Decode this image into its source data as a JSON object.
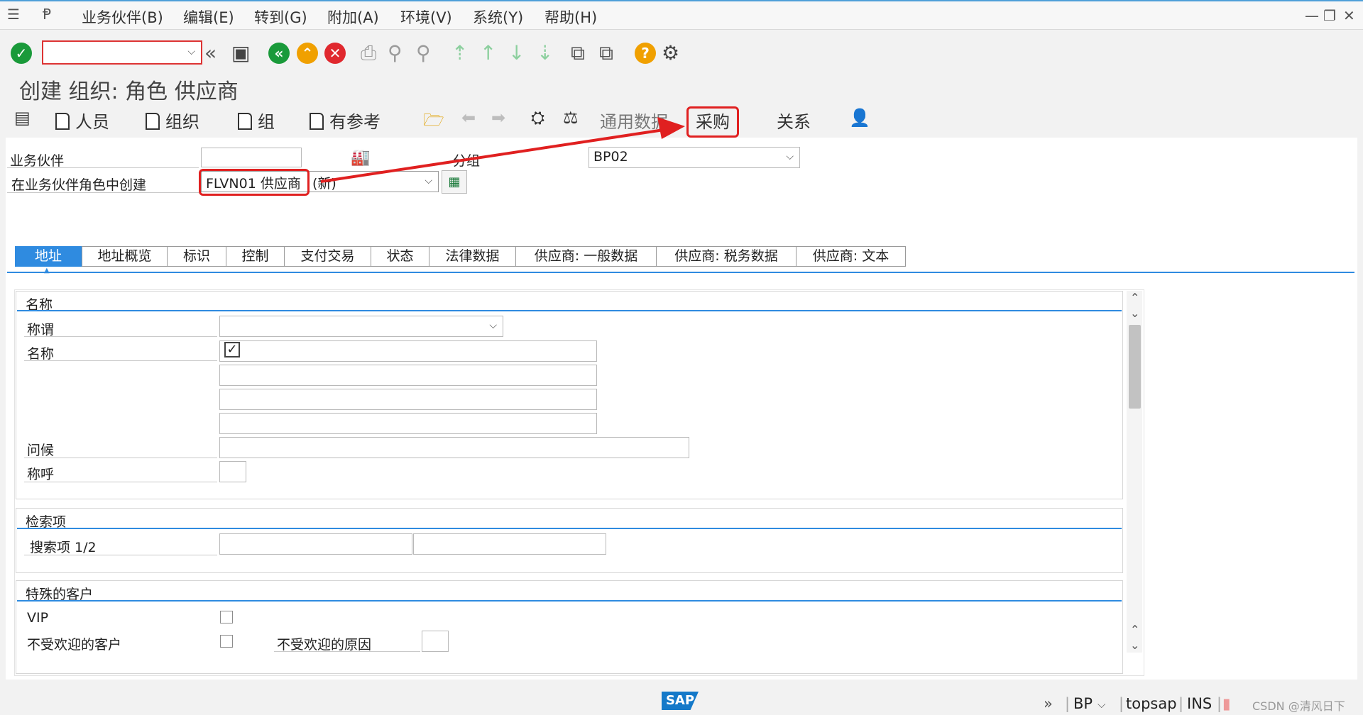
{
  "menu": {
    "items": [
      {
        "label": "业务伙伴(B)"
      },
      {
        "label": "编辑(E)"
      },
      {
        "label": "转到(G)"
      },
      {
        "label": "附加(A)"
      },
      {
        "label": "环境(V)"
      },
      {
        "label": "系统(Y)"
      },
      {
        "label": "帮助(H)"
      }
    ]
  },
  "toolbar": {
    "command_value": "",
    "icons": [
      "enter-icon",
      "back-icon",
      "exit-icon",
      "cancel-icon",
      "save-icon",
      "print-icon",
      "find-icon",
      "help-icon",
      "settings-icon"
    ]
  },
  "title": "创建 组织: 角色 供应商",
  "app_toolbar": {
    "person": "人员",
    "organization": "组织",
    "group": "组",
    "with_reference": "有参考",
    "general_data": "通用数据",
    "purchasing": "采购",
    "relations": "关系"
  },
  "header": {
    "bp_label": "业务伙伴",
    "bp_value": "",
    "grouping_label": "分组",
    "grouping_value": "BP02",
    "role_label": "在业务伙伴角色中创建",
    "role_value": "FLVN01 供应商",
    "role_suffix": "(新)"
  },
  "tabs": [
    "地址",
    "地址概览",
    "标识",
    "控制",
    "支付交易",
    "状态",
    "法律数据",
    "供应商: 一般数据",
    "供应商: 税务数据",
    "供应商: 文本"
  ],
  "active_tab": "地址",
  "name_group": {
    "title": "名称",
    "title_label": "称谓",
    "title_value": "",
    "name_label": "名称",
    "name_value": "",
    "greeting_label": "问候",
    "greeting_value": "",
    "salutation_label": "称呼",
    "salutation_value": ""
  },
  "search_group": {
    "title": "检索项",
    "search_label": "搜索项 1/2",
    "search1": "",
    "search2": ""
  },
  "special_group": {
    "title": "特殊的客户",
    "vip_label": "VIP",
    "vip_checked": false,
    "undesired_label": "不受欢迎的客户",
    "undesired_checked": false,
    "reason_label": "不受欢迎的原因",
    "reason_value": ""
  },
  "statusbar": {
    "sap_logo": "SAP",
    "tcode": "BP",
    "server": "topsap",
    "mode": "INS",
    "watermark": "CSDN @清风日下"
  },
  "colors": {
    "accent": "#2f8be0",
    "annotation": "#e02020",
    "ok_green": "#1a9a3a"
  }
}
